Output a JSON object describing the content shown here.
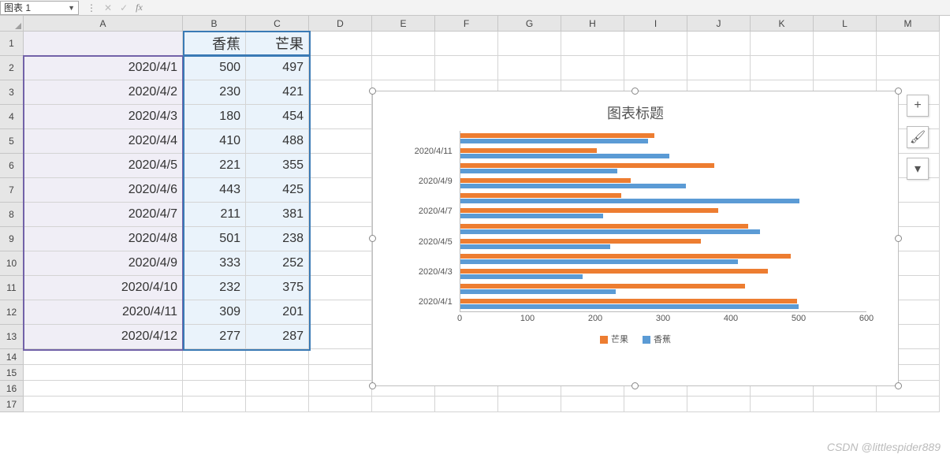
{
  "namebox": "图表 1",
  "columns": [
    "A",
    "B",
    "C",
    "D",
    "E",
    "F",
    "G",
    "H",
    "I",
    "J",
    "K",
    "L",
    "M"
  ],
  "headers": {
    "B": "香蕉",
    "C": "芒果"
  },
  "table": [
    {
      "date": "2020/4/1",
      "b": 500,
      "c": 497
    },
    {
      "date": "2020/4/2",
      "b": 230,
      "c": 421
    },
    {
      "date": "2020/4/3",
      "b": 180,
      "c": 454
    },
    {
      "date": "2020/4/4",
      "b": 410,
      "c": 488
    },
    {
      "date": "2020/4/5",
      "b": 221,
      "c": 355
    },
    {
      "date": "2020/4/6",
      "b": 443,
      "c": 425
    },
    {
      "date": "2020/4/7",
      "b": 211,
      "c": 381
    },
    {
      "date": "2020/4/8",
      "b": 501,
      "c": 238
    },
    {
      "date": "2020/4/9",
      "b": 333,
      "c": 252
    },
    {
      "date": "2020/4/10",
      "b": 232,
      "c": 375
    },
    {
      "date": "2020/4/11",
      "b": 309,
      "c": 201
    },
    {
      "date": "2020/4/12",
      "b": 277,
      "c": 287
    }
  ],
  "chart": {
    "title": "图表标题",
    "legend": [
      "芒果",
      "香蕉"
    ],
    "colors": {
      "芒果": "#ed7d31",
      "香蕉": "#5b9bd5"
    },
    "y_ticks": [
      "2020/4/1",
      "2020/4/3",
      "2020/4/5",
      "2020/4/7",
      "2020/4/9",
      "2020/4/11"
    ],
    "x_ticks": [
      0,
      100,
      200,
      300,
      400,
      500,
      600
    ],
    "x_max": 600
  },
  "side_buttons": [
    "+",
    "brush",
    "filter"
  ],
  "watermark": "CSDN @littlespider889",
  "chart_data": {
    "type": "bar",
    "orientation": "horizontal",
    "title": "图表标题",
    "xlabel": "",
    "ylabel": "",
    "xlim": [
      0,
      600
    ],
    "categories": [
      "2020/4/1",
      "2020/4/2",
      "2020/4/3",
      "2020/4/4",
      "2020/4/5",
      "2020/4/6",
      "2020/4/7",
      "2020/4/8",
      "2020/4/9",
      "2020/4/10",
      "2020/4/11",
      "2020/4/12"
    ],
    "series": [
      {
        "name": "芒果",
        "color": "#ed7d31",
        "values": [
          497,
          421,
          454,
          488,
          355,
          425,
          381,
          238,
          252,
          375,
          201,
          287
        ]
      },
      {
        "name": "香蕉",
        "color": "#5b9bd5",
        "values": [
          500,
          230,
          180,
          410,
          221,
          443,
          211,
          501,
          333,
          232,
          309,
          277
        ]
      }
    ]
  }
}
